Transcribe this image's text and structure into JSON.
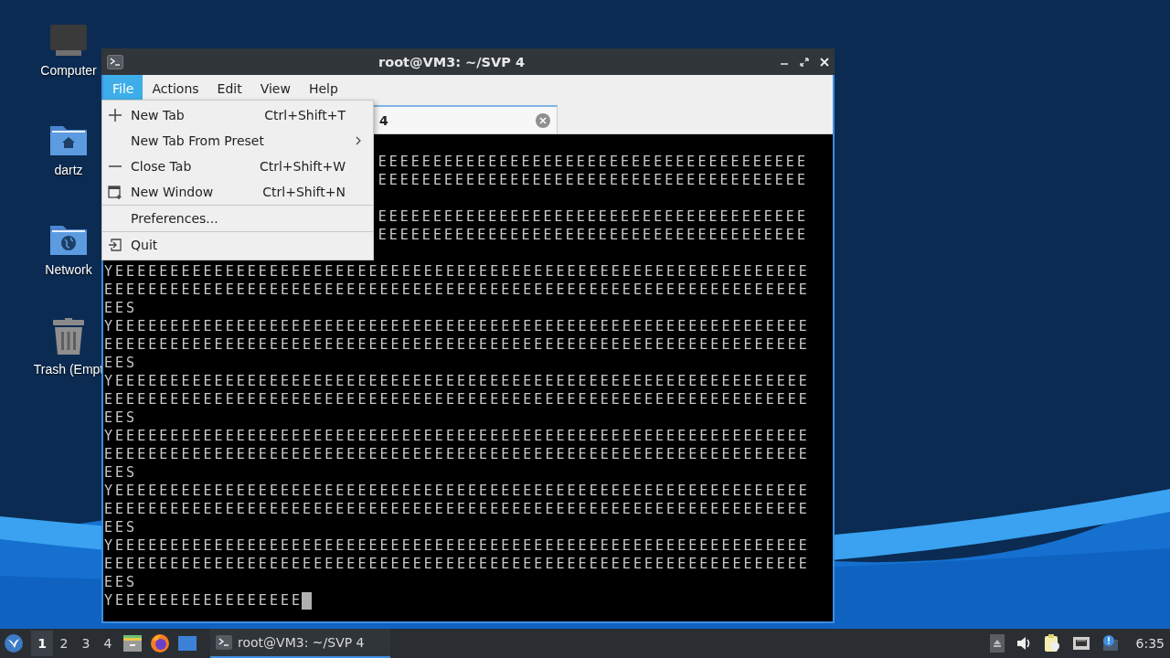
{
  "desktop_icons": [
    {
      "label": "Computer",
      "kind": "computer"
    },
    {
      "label": "dartz",
      "kind": "home"
    },
    {
      "label": "Network",
      "kind": "network"
    },
    {
      "label": "Trash (Empt",
      "kind": "trash"
    }
  ],
  "window": {
    "title": "root@VM3: ~/SVP 4",
    "menu_bar": [
      {
        "label": "File",
        "selected": true
      },
      {
        "label": "Actions",
        "selected": false
      },
      {
        "label": "Edit",
        "selected": false
      },
      {
        "label": "View",
        "selected": false
      },
      {
        "label": "Help",
        "selected": false
      }
    ],
    "tab": {
      "label": "4",
      "selected": true
    },
    "terminal": {
      "lines": [
        {
          "kind": "gap"
        },
        {
          "kind": "covered",
          "text": "EEEEEEEEEEEEEEEEEEEEEEEEEEEEEEEEEEEEEEE"
        },
        {
          "kind": "covered",
          "text": "EEEEEEEEEEEEEEEEEEEEEEEEEEEEEEEEEEEEEEE"
        },
        {
          "kind": "gap"
        },
        {
          "kind": "covered",
          "text": "EEEEEEEEEEEEEEEEEEEEEEEEEEEEEEEEEEEEEEE"
        },
        {
          "kind": "covered",
          "text": "EEEEEEEEEEEEEEEEEEEEEEEEEEEEEEEEEEEEEEE"
        },
        {
          "kind": "gap"
        },
        {
          "kind": "line",
          "text": "YEEEEEEEEEEEEEEEEEEEEEEEEEEEEEEEEEEEEEEEEEEEEEEEEEEEEEEEEEEEEEEE"
        },
        {
          "kind": "line",
          "text": "EEEEEEEEEEEEEEEEEEEEEEEEEEEEEEEEEEEEEEEEEEEEEEEEEEEEEEEEEEEEEEEE"
        },
        {
          "kind": "line",
          "text": "EES"
        },
        {
          "kind": "line",
          "text": "YEEEEEEEEEEEEEEEEEEEEEEEEEEEEEEEEEEEEEEEEEEEEEEEEEEEEEEEEEEEEEEE"
        },
        {
          "kind": "line",
          "text": "EEEEEEEEEEEEEEEEEEEEEEEEEEEEEEEEEEEEEEEEEEEEEEEEEEEEEEEEEEEEEEEE"
        },
        {
          "kind": "line",
          "text": "EES"
        },
        {
          "kind": "line",
          "text": "YEEEEEEEEEEEEEEEEEEEEEEEEEEEEEEEEEEEEEEEEEEEEEEEEEEEEEEEEEEEEEEE"
        },
        {
          "kind": "line",
          "text": "EEEEEEEEEEEEEEEEEEEEEEEEEEEEEEEEEEEEEEEEEEEEEEEEEEEEEEEEEEEEEEEE"
        },
        {
          "kind": "line",
          "text": "EES"
        },
        {
          "kind": "line",
          "text": "YEEEEEEEEEEEEEEEEEEEEEEEEEEEEEEEEEEEEEEEEEEEEEEEEEEEEEEEEEEEEEEE"
        },
        {
          "kind": "line",
          "text": "EEEEEEEEEEEEEEEEEEEEEEEEEEEEEEEEEEEEEEEEEEEEEEEEEEEEEEEEEEEEEEEE"
        },
        {
          "kind": "line",
          "text": "EES"
        },
        {
          "kind": "line",
          "text": "YEEEEEEEEEEEEEEEEEEEEEEEEEEEEEEEEEEEEEEEEEEEEEEEEEEEEEEEEEEEEEEE"
        },
        {
          "kind": "line",
          "text": "EEEEEEEEEEEEEEEEEEEEEEEEEEEEEEEEEEEEEEEEEEEEEEEEEEEEEEEEEEEEEEEE"
        },
        {
          "kind": "line",
          "text": "EES"
        },
        {
          "kind": "line",
          "text": "YEEEEEEEEEEEEEEEEEEEEEEEEEEEEEEEEEEEEEEEEEEEEEEEEEEEEEEEEEEEEEEE"
        },
        {
          "kind": "line",
          "text": "EEEEEEEEEEEEEEEEEEEEEEEEEEEEEEEEEEEEEEEEEEEEEEEEEEEEEEEEEEEEEEEE"
        },
        {
          "kind": "line",
          "text": "EES"
        },
        {
          "kind": "prompt",
          "text": "YEEEEEEEEEEEEEEEEE"
        }
      ]
    }
  },
  "file_menu": [
    {
      "kind": "plus",
      "label": "New Tab",
      "shortcut": "Ctrl+Shift+T"
    },
    {
      "kind": "submenu",
      "label": "New Tab From Preset"
    },
    {
      "kind": "minus",
      "label": "Close Tab",
      "shortcut": "Ctrl+Shift+W"
    },
    {
      "kind": "window",
      "label": "New Window",
      "shortcut": "Ctrl+Shift+N"
    },
    {
      "kind": "separator"
    },
    {
      "kind": "plain",
      "label": "Preferences..."
    },
    {
      "kind": "separator"
    },
    {
      "kind": "quit",
      "label": "Quit"
    }
  ],
  "taskbar": {
    "workspaces": [
      {
        "label": "1",
        "selected": true
      },
      {
        "label": "2",
        "selected": false
      },
      {
        "label": "3",
        "selected": false
      },
      {
        "label": "4",
        "selected": false
      }
    ],
    "task": {
      "label": "root@VM3: ~/SVP 4",
      "selected": true
    },
    "clock": "6:35"
  }
}
